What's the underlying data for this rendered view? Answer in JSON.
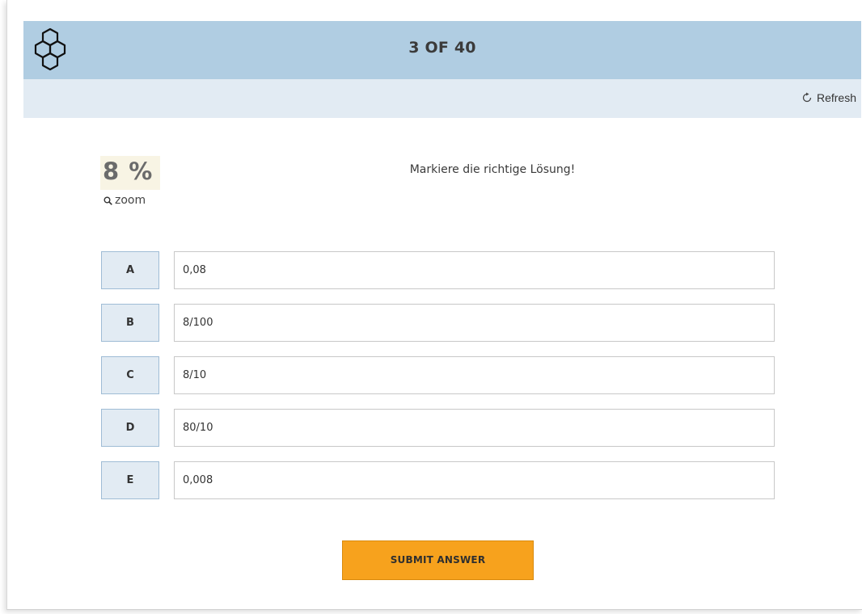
{
  "header": {
    "counter": "3 OF 40",
    "logo_icon": "hexagon-grid-icon"
  },
  "toolbar": {
    "refresh_label": "Refresh",
    "refresh_icon": "refresh-icon"
  },
  "question": {
    "image_text": "8 %",
    "zoom_label": "zoom",
    "zoom_icon": "search-icon",
    "prompt": "Markiere die richtige Lösung!"
  },
  "options": [
    {
      "key": "A",
      "value": "0,08"
    },
    {
      "key": "B",
      "value": "8/100"
    },
    {
      "key": "C",
      "value": "8/10"
    },
    {
      "key": "D",
      "value": "80/10"
    },
    {
      "key": "E",
      "value": "0,008"
    }
  ],
  "submit_label": "SUBMIT ANSWER",
  "colors": {
    "header_bg": "#b0cde2",
    "subbar_bg": "#e2ebf3",
    "option_key_bg": "#e2ebf3",
    "submit_bg": "#f7a21d"
  }
}
